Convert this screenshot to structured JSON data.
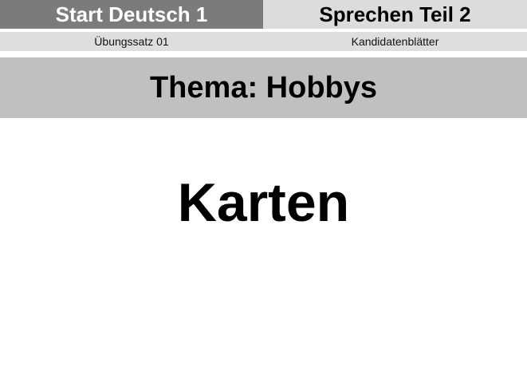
{
  "header": {
    "left_title": "Start Deutsch 1",
    "right_title": "Sprechen Teil 2",
    "left_sub": "Übungssatz 01",
    "right_sub": "Kandidatenblätter"
  },
  "theme": "Thema: Hobbys",
  "heading": "Karten"
}
